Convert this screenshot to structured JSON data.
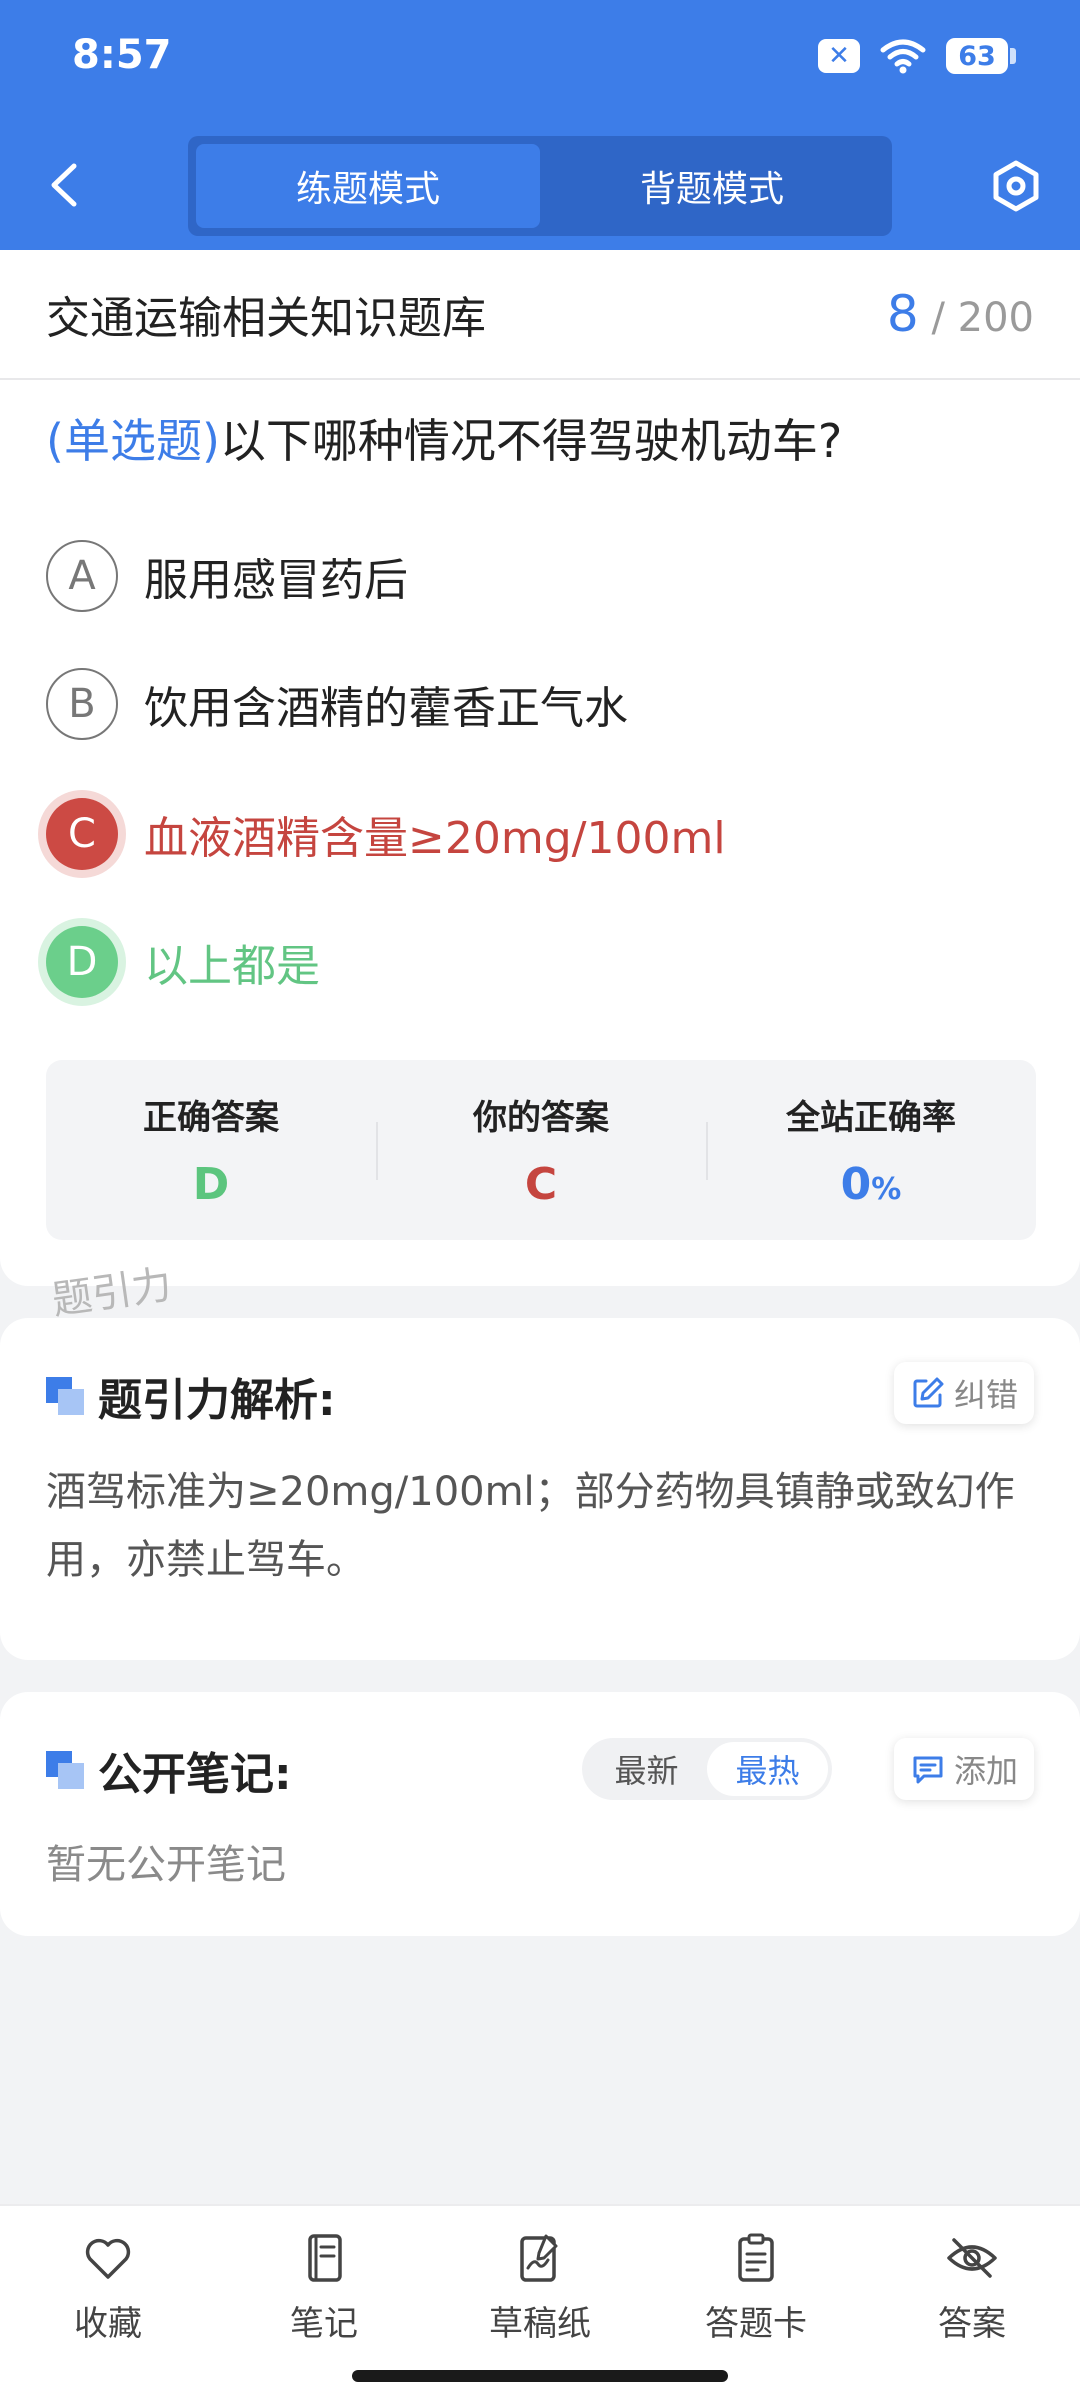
{
  "status_bar": {
    "time": "8:57",
    "battery": "63"
  },
  "header": {
    "mode_tabs": [
      {
        "label": "练题模式",
        "active": true
      },
      {
        "label": "背题模式",
        "active": false
      }
    ]
  },
  "question_bank": {
    "title": "交通运输相关知识题库",
    "current": "8",
    "total": "/ 200"
  },
  "question": {
    "type": "(单选题)",
    "text": "以下哪种情况不得驾驶机动车?",
    "options": [
      {
        "letter": "A",
        "text": "服用感冒药后",
        "state": "normal"
      },
      {
        "letter": "B",
        "text": "饮用含酒精的藿香正气水",
        "state": "normal"
      },
      {
        "letter": "C",
        "text": "血液酒精含量≥20mg/100ml",
        "state": "wrong"
      },
      {
        "letter": "D",
        "text": "以上都是",
        "state": "correct"
      }
    ]
  },
  "answer_summary": {
    "correct_label": "正确答案",
    "correct_value": "D",
    "yours_label": "你的答案",
    "yours_value": "C",
    "rate_label": "全站正确率",
    "rate_value": "0",
    "rate_unit": "%"
  },
  "watermark": "题引力",
  "analysis": {
    "title": "题引力解析:",
    "report_label": "纠错",
    "text": "酒驾标准为≥20mg/100ml；部分药物具镇静或致幻作用，亦禁止驾车。"
  },
  "notes": {
    "title": "公开笔记:",
    "sort_options": [
      "最新",
      "最热"
    ],
    "active_sort": "最热",
    "add_label": "添加",
    "empty_text": "暂无公开笔记"
  },
  "bottom_nav": [
    {
      "label": "收藏",
      "icon": "heart-icon"
    },
    {
      "label": "笔记",
      "icon": "notebook-icon"
    },
    {
      "label": "草稿纸",
      "icon": "draft-paper-icon"
    },
    {
      "label": "答题卡",
      "icon": "answer-sheet-icon"
    },
    {
      "label": "答案",
      "icon": "eye-off-icon"
    }
  ],
  "colors": {
    "primary": "#3d7de8",
    "wrong": "#c5453f",
    "correct": "#5cc57e"
  }
}
